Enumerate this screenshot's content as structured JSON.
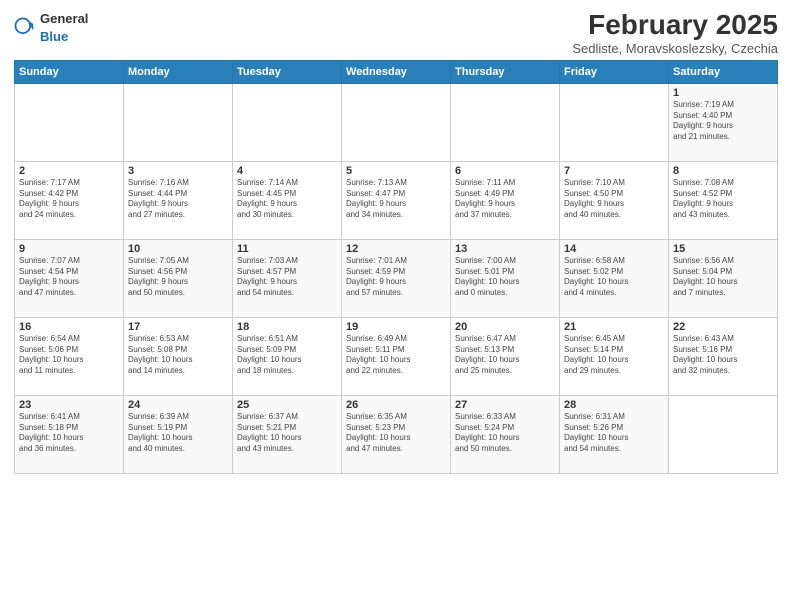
{
  "header": {
    "logo_general": "General",
    "logo_blue": "Blue",
    "title": "February 2025",
    "subtitle": "Sedliste, Moravskoslezsky, Czechia"
  },
  "days_of_week": [
    "Sunday",
    "Monday",
    "Tuesday",
    "Wednesday",
    "Thursday",
    "Friday",
    "Saturday"
  ],
  "weeks": [
    [
      {
        "day": "",
        "info": ""
      },
      {
        "day": "",
        "info": ""
      },
      {
        "day": "",
        "info": ""
      },
      {
        "day": "",
        "info": ""
      },
      {
        "day": "",
        "info": ""
      },
      {
        "day": "",
        "info": ""
      },
      {
        "day": "1",
        "info": "Sunrise: 7:19 AM\nSunset: 4:40 PM\nDaylight: 9 hours\nand 21 minutes."
      }
    ],
    [
      {
        "day": "2",
        "info": "Sunrise: 7:17 AM\nSunset: 4:42 PM\nDaylight: 9 hours\nand 24 minutes."
      },
      {
        "day": "3",
        "info": "Sunrise: 7:16 AM\nSunset: 4:44 PM\nDaylight: 9 hours\nand 27 minutes."
      },
      {
        "day": "4",
        "info": "Sunrise: 7:14 AM\nSunset: 4:45 PM\nDaylight: 9 hours\nand 30 minutes."
      },
      {
        "day": "5",
        "info": "Sunrise: 7:13 AM\nSunset: 4:47 PM\nDaylight: 9 hours\nand 34 minutes."
      },
      {
        "day": "6",
        "info": "Sunrise: 7:11 AM\nSunset: 4:49 PM\nDaylight: 9 hours\nand 37 minutes."
      },
      {
        "day": "7",
        "info": "Sunrise: 7:10 AM\nSunset: 4:50 PM\nDaylight: 9 hours\nand 40 minutes."
      },
      {
        "day": "8",
        "info": "Sunrise: 7:08 AM\nSunset: 4:52 PM\nDaylight: 9 hours\nand 43 minutes."
      }
    ],
    [
      {
        "day": "9",
        "info": "Sunrise: 7:07 AM\nSunset: 4:54 PM\nDaylight: 9 hours\nand 47 minutes."
      },
      {
        "day": "10",
        "info": "Sunrise: 7:05 AM\nSunset: 4:56 PM\nDaylight: 9 hours\nand 50 minutes."
      },
      {
        "day": "11",
        "info": "Sunrise: 7:03 AM\nSunset: 4:57 PM\nDaylight: 9 hours\nand 54 minutes."
      },
      {
        "day": "12",
        "info": "Sunrise: 7:01 AM\nSunset: 4:59 PM\nDaylight: 9 hours\nand 57 minutes."
      },
      {
        "day": "13",
        "info": "Sunrise: 7:00 AM\nSunset: 5:01 PM\nDaylight: 10 hours\nand 0 minutes."
      },
      {
        "day": "14",
        "info": "Sunrise: 6:58 AM\nSunset: 5:02 PM\nDaylight: 10 hours\nand 4 minutes."
      },
      {
        "day": "15",
        "info": "Sunrise: 6:56 AM\nSunset: 5:04 PM\nDaylight: 10 hours\nand 7 minutes."
      }
    ],
    [
      {
        "day": "16",
        "info": "Sunrise: 6:54 AM\nSunset: 5:06 PM\nDaylight: 10 hours\nand 11 minutes."
      },
      {
        "day": "17",
        "info": "Sunrise: 6:53 AM\nSunset: 5:08 PM\nDaylight: 10 hours\nand 14 minutes."
      },
      {
        "day": "18",
        "info": "Sunrise: 6:51 AM\nSunset: 5:09 PM\nDaylight: 10 hours\nand 18 minutes."
      },
      {
        "day": "19",
        "info": "Sunrise: 6:49 AM\nSunset: 5:11 PM\nDaylight: 10 hours\nand 22 minutes."
      },
      {
        "day": "20",
        "info": "Sunrise: 6:47 AM\nSunset: 5:13 PM\nDaylight: 10 hours\nand 25 minutes."
      },
      {
        "day": "21",
        "info": "Sunrise: 6:45 AM\nSunset: 5:14 PM\nDaylight: 10 hours\nand 29 minutes."
      },
      {
        "day": "22",
        "info": "Sunrise: 6:43 AM\nSunset: 5:16 PM\nDaylight: 10 hours\nand 32 minutes."
      }
    ],
    [
      {
        "day": "23",
        "info": "Sunrise: 6:41 AM\nSunset: 5:18 PM\nDaylight: 10 hours\nand 36 minutes."
      },
      {
        "day": "24",
        "info": "Sunrise: 6:39 AM\nSunset: 5:19 PM\nDaylight: 10 hours\nand 40 minutes."
      },
      {
        "day": "25",
        "info": "Sunrise: 6:37 AM\nSunset: 5:21 PM\nDaylight: 10 hours\nand 43 minutes."
      },
      {
        "day": "26",
        "info": "Sunrise: 6:35 AM\nSunset: 5:23 PM\nDaylight: 10 hours\nand 47 minutes."
      },
      {
        "day": "27",
        "info": "Sunrise: 6:33 AM\nSunset: 5:24 PM\nDaylight: 10 hours\nand 50 minutes."
      },
      {
        "day": "28",
        "info": "Sunrise: 6:31 AM\nSunset: 5:26 PM\nDaylight: 10 hours\nand 54 minutes."
      },
      {
        "day": "",
        "info": ""
      }
    ]
  ]
}
